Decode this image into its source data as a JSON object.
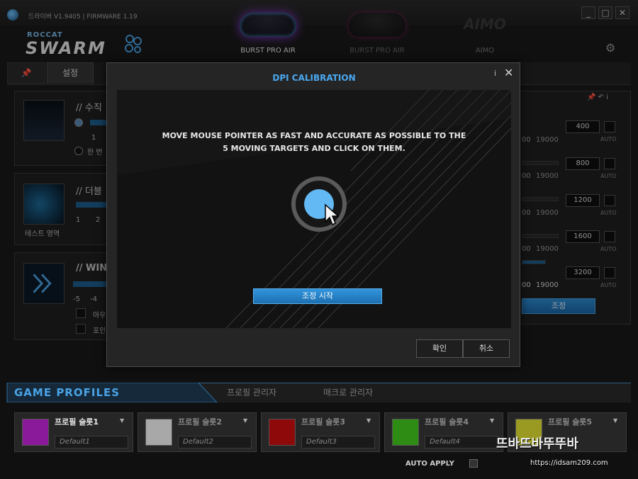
{
  "titlebar": {
    "version_text": "드라이버 V1.9405 | FIRMWARE 1.19",
    "minimize": "_",
    "maximize": "□",
    "close": "✕"
  },
  "header": {
    "logo_small": "ROCCAT",
    "logo_big": "SWARM",
    "devices": [
      {
        "label": "BURST PRO AIR",
        "active": true
      },
      {
        "label": "BURST PRO AIR",
        "active": false
      },
      {
        "label": "AIMO",
        "active": false
      }
    ],
    "aimo_logo": "AIMO",
    "gear_icon": "gear-icon"
  },
  "tabs": {
    "pin_icon": "pin-icon",
    "settings_label": "설정"
  },
  "left_panels": {
    "panel1": {
      "title": "// 수직",
      "num": "1",
      "radio2": "한 번"
    },
    "panel2": {
      "title": "// 더블",
      "caption": "테스트 영역",
      "nums": [
        "1",
        "2"
      ]
    },
    "panel3": {
      "title": "// WIN",
      "nums": [
        "-5",
        "-4"
      ],
      "opt1": "마우",
      "opt2": "포인"
    }
  },
  "dpi": {
    "rows": [
      {
        "value": "400",
        "max": "19000",
        "prefix": "00",
        "auto": "AUTO"
      },
      {
        "value": "800",
        "max": "19000",
        "prefix": "00",
        "auto": "AUTO"
      },
      {
        "value": "1200",
        "max": "19000",
        "prefix": "00",
        "auto": "AUTO"
      },
      {
        "value": "1600",
        "max": "19000",
        "prefix": "00",
        "auto": "AUTO"
      },
      {
        "value": "3200",
        "max": "19000",
        "prefix": "00",
        "auto": "AUTO"
      }
    ],
    "calibrate_label": "조정",
    "top_icons": "📌 ↶ i"
  },
  "modal": {
    "title": "DPI CALIBRATION",
    "info_icon": "i",
    "close_icon": "✕",
    "instruction": "MOVE MOUSE POINTER AS FAST AND ACCURATE AS POSSIBLE TO THE 5 MOVING TARGETS AND CLICK ON THEM.",
    "start_label": "조정 시작",
    "ok_label": "확인",
    "cancel_label": "취소"
  },
  "game_profiles": {
    "title": "GAME PROFILES",
    "tab_profile_manager": "프로필 관리자",
    "tab_macro_manager": "매크로 관리자",
    "slots": [
      {
        "name": "프로필 슬롯1",
        "default": "Default1",
        "color": "#8b1a9a",
        "active": true
      },
      {
        "name": "프로필 슬롯2",
        "default": "Default2",
        "color": "#a8a8a8",
        "active": false
      },
      {
        "name": "프로필 슬롯3",
        "default": "Default3",
        "color": "#8e0a0a",
        "active": false
      },
      {
        "name": "프로필 슬롯4",
        "default": "Default4",
        "color": "#2e8c14",
        "active": false
      },
      {
        "name": "프로필 슬롯5",
        "default": "",
        "color": "#9a9a22",
        "active": false
      }
    ],
    "auto_apply": "AUTO APPLY"
  },
  "watermark": {
    "text": "뜨바뜨바뚜뚜바",
    "url": "https://idsam209.com"
  }
}
